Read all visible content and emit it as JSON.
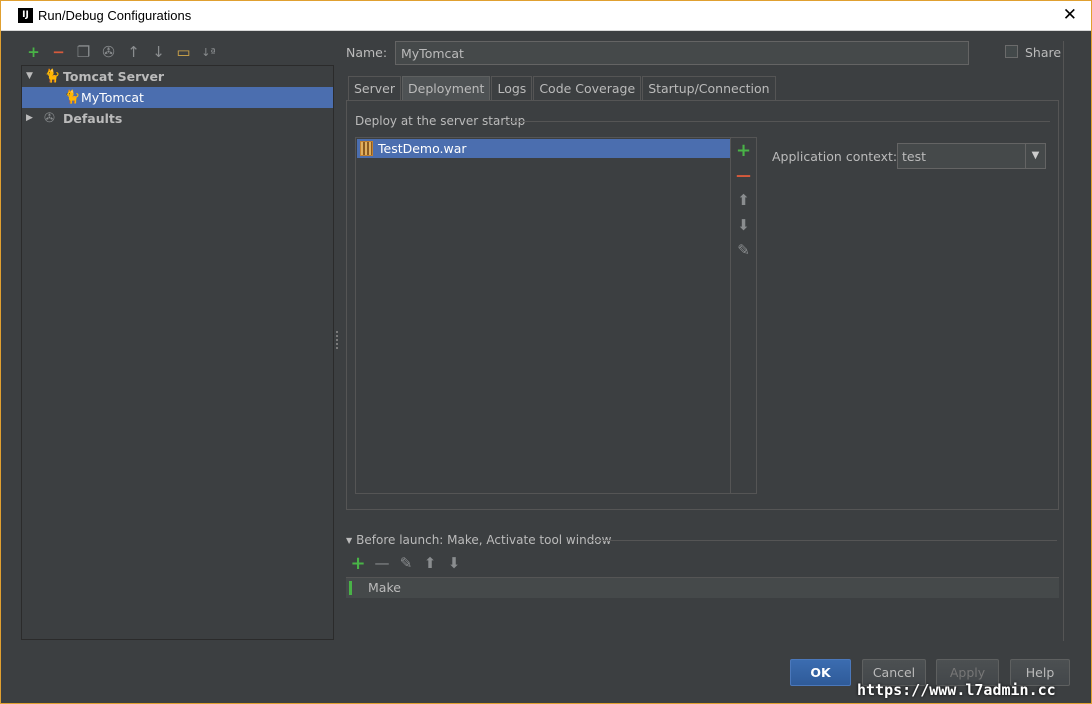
{
  "window": {
    "title": "Run/Debug Configurations",
    "close_glyph": "✕",
    "app_icon_text": "IJ"
  },
  "left_toolbar": {
    "buttons": [
      {
        "name": "add-configuration-button",
        "glyph": "+",
        "icon": "plus-icon"
      },
      {
        "name": "remove-configuration-button",
        "glyph": "−",
        "icon": "minus-icon"
      },
      {
        "name": "copy-configuration-button",
        "glyph": "❐",
        "icon": "copy-icon"
      },
      {
        "name": "edit-defaults-button",
        "glyph": "✇",
        "icon": "wrench-icon"
      },
      {
        "name": "move-up-button",
        "glyph": "↑",
        "icon": "arrow-up-icon"
      },
      {
        "name": "move-down-button",
        "glyph": "↓",
        "icon": "arrow-down-icon"
      },
      {
        "name": "folder-button",
        "glyph": "▭",
        "icon": "folder-icon"
      },
      {
        "name": "sort-button",
        "glyph": "↓ª",
        "icon": "sort-icon"
      }
    ]
  },
  "tree": {
    "items": [
      {
        "label": "Tomcat Server",
        "expanded": true,
        "arrow": "▼",
        "icon": "🐈"
      },
      {
        "label": "MyTomcat",
        "selected": true,
        "icon": "🐈"
      },
      {
        "label": "Defaults",
        "expanded": false,
        "arrow": "▶",
        "icon": "✇"
      }
    ]
  },
  "form": {
    "name_label": "Name:",
    "name_value": "MyTomcat",
    "share_label": "Share",
    "share_checked": false
  },
  "tabs": [
    {
      "label": "Server",
      "active": false
    },
    {
      "label": "Deployment",
      "active": true
    },
    {
      "label": "Logs",
      "active": false
    },
    {
      "label": "Code Coverage",
      "active": false
    },
    {
      "label": "Startup/Connection",
      "active": false
    }
  ],
  "deployment": {
    "header": "Deploy at the server startup",
    "artifacts": [
      "TestDemo.war"
    ],
    "tools": [
      {
        "name": "add-artifact-button",
        "glyph": "+",
        "icon": "plus-icon",
        "color": "#49b347"
      },
      {
        "name": "remove-artifact-button",
        "glyph": "—",
        "icon": "minus-icon",
        "color": "#d65a3c"
      },
      {
        "name": "move-artifact-up-button",
        "glyph": "⬆",
        "icon": "arrow-up-icon",
        "color": "#8a8d8f"
      },
      {
        "name": "move-artifact-down-button",
        "glyph": "⬇",
        "icon": "arrow-down-icon",
        "color": "#8a8d8f"
      },
      {
        "name": "edit-artifact-button",
        "glyph": "✎",
        "icon": "pencil-icon",
        "color": "#8a8d8f"
      }
    ],
    "context_label": "Application context:",
    "context_value": "test",
    "dropdown_glyph": "▼"
  },
  "before_launch": {
    "label": "Before launch: Make, Activate tool window",
    "arrow": "▼",
    "tools": [
      {
        "name": "add-task-button",
        "glyph": "+",
        "icon": "plus-icon",
        "color": "#49b347"
      },
      {
        "name": "remove-task-button",
        "glyph": "—",
        "icon": "minus-icon",
        "color": "#8a8d8f"
      },
      {
        "name": "edit-task-button",
        "glyph": "✎",
        "icon": "pencil-icon",
        "color": "#8a8d8f"
      },
      {
        "name": "move-task-up-button",
        "glyph": "⬆",
        "icon": "arrow-up-icon",
        "color": "#8a8d8f"
      },
      {
        "name": "move-task-down-button",
        "glyph": "⬇",
        "icon": "arrow-down-icon",
        "color": "#8a8d8f"
      }
    ],
    "tasks": [
      "Make"
    ],
    "make_icon_digits": "01\n10\n01"
  },
  "buttons": {
    "ok": "OK",
    "cancel": "Cancel",
    "apply": "Apply",
    "help": "Help"
  },
  "watermark": "https://www.l7admin.cc",
  "colors": {
    "selection": "#4b6eaf",
    "primary_button": "#2f5b99",
    "add_green": "#49b347",
    "remove_red": "#d65a3c",
    "window_border": "#e0a030"
  }
}
